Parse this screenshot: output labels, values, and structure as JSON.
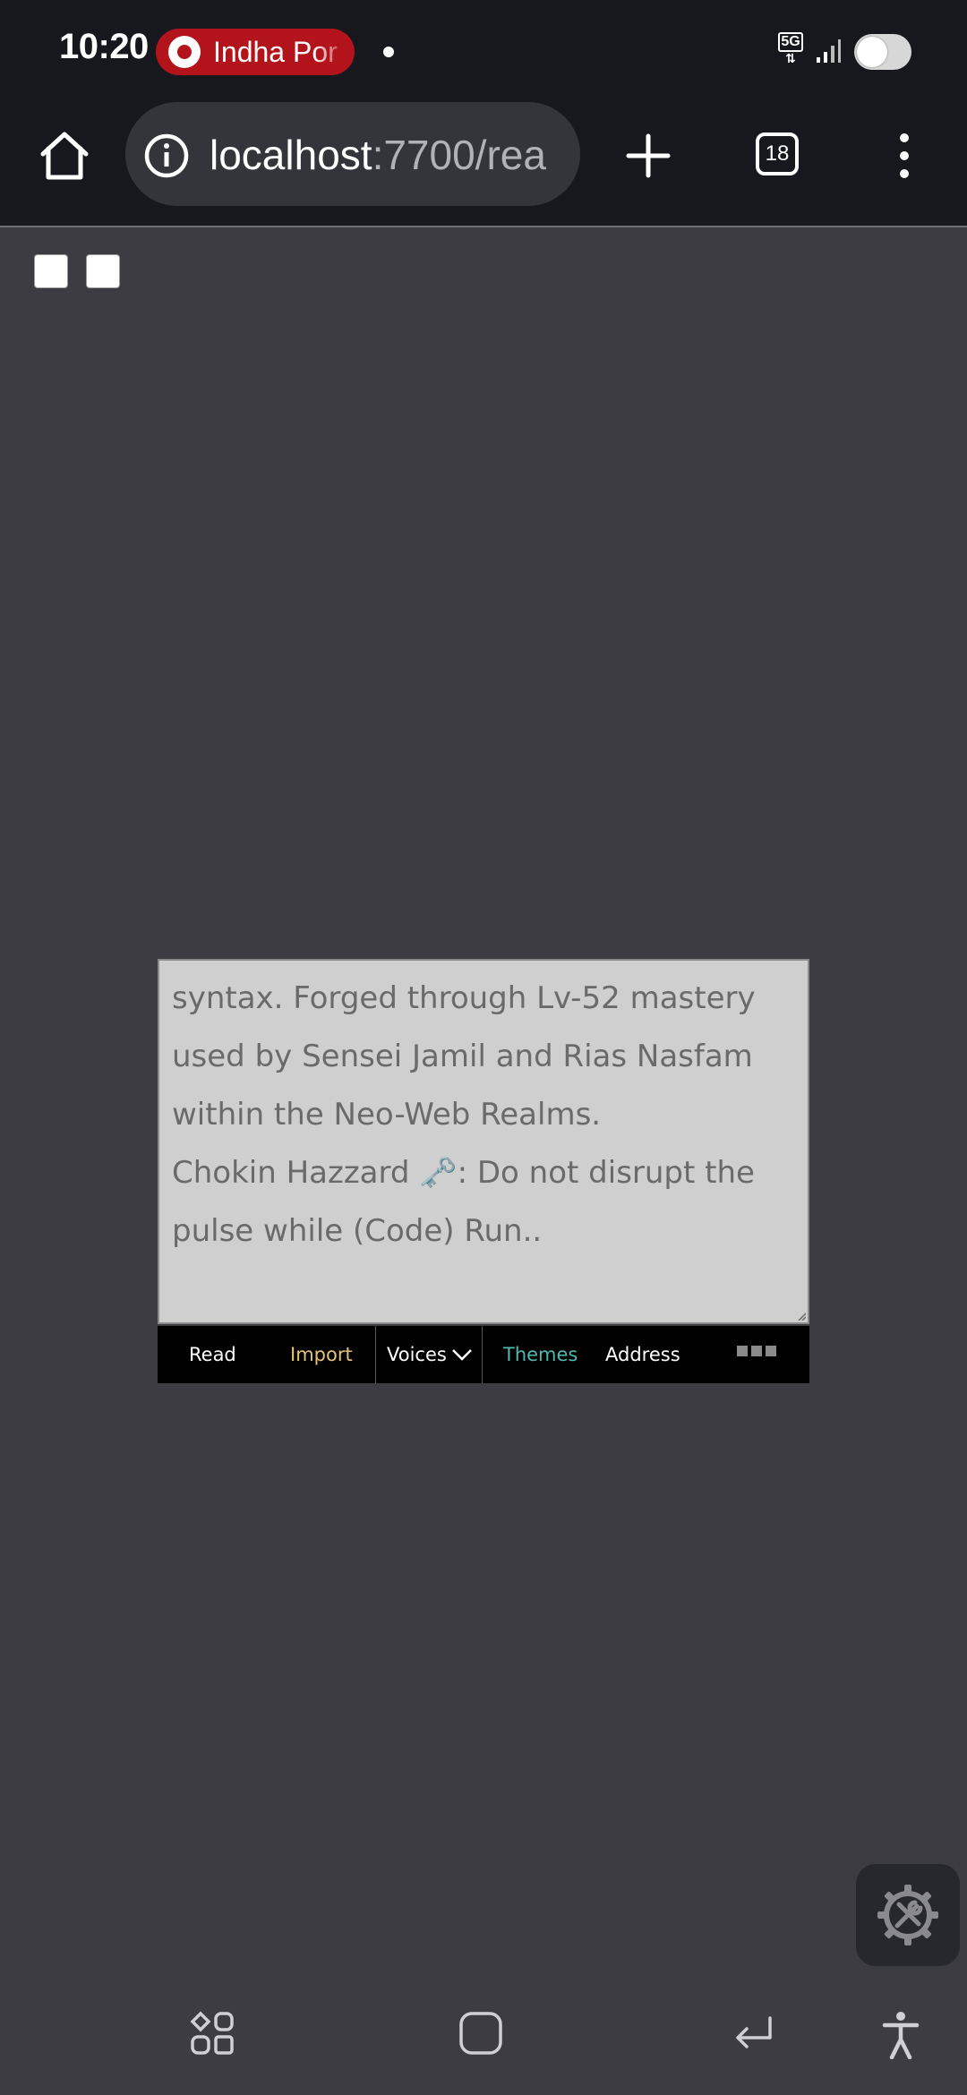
{
  "status_bar": {
    "time": "10:20",
    "notification_text": "Indha Por",
    "network_label": "5G"
  },
  "browser": {
    "url_host": "localhost",
    "url_path": ":7700/rea",
    "tab_count": "18"
  },
  "reader": {
    "text": "syntax. Forged through Lv-52 mastery\nused by Sensei Jamil and Rias Nasfam\nwithin the Neo-Web Realms.\nChokin Hazzard 🗝️: Do not disrupt the\npulse while (Code) Run.."
  },
  "reader_toolbar": {
    "read": "Read",
    "import": "Import",
    "voices": "Voices",
    "themes": "Themes",
    "address": "Address"
  },
  "colors": {
    "import": "#e8c07a",
    "themes": "#4fb8b0",
    "notification_pill": "#b3141c"
  }
}
